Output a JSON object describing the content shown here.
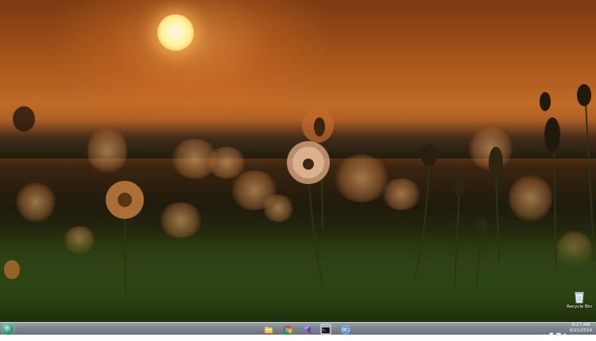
{
  "desktop": {
    "wallpaper": "sunset dandelion field",
    "icons": [
      {
        "name": "recycle-bin-icon",
        "label": "Recycle Bin"
      }
    ]
  },
  "taskbar": {
    "start_button": "start-orb-icon",
    "pinned": [
      {
        "name": "file-explorer-icon"
      },
      {
        "name": "chrome-icon"
      },
      {
        "name": "visual-studio-icon"
      },
      {
        "name": "command-prompt-icon"
      },
      {
        "name": "globe-icon"
      }
    ],
    "tray": {
      "icons": [
        "show-hidden-icons",
        "flag-icon",
        "network-icon",
        "volume-icon"
      ],
      "time": "8:27 AM",
      "date": "6/21/2014"
    }
  },
  "colors": {
    "sky": "#b85f22",
    "sun": "#ffef9a",
    "taskbar": "#7d868e",
    "grass": "#2c4412"
  }
}
